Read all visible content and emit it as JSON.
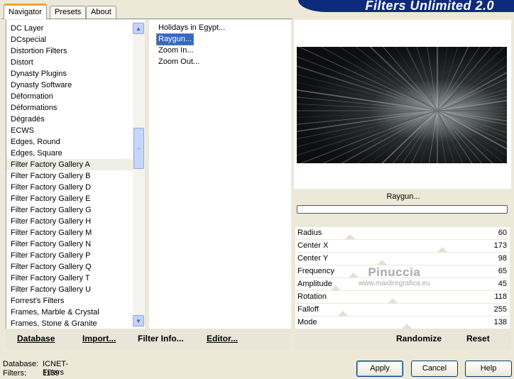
{
  "banner": {
    "title": "Filters Unlimited 2.0"
  },
  "tabs": [
    {
      "label": "Navigator"
    },
    {
      "label": "Presets"
    },
    {
      "label": "About"
    }
  ],
  "categories": [
    "DC Layer",
    "DCspecial",
    "Distortion Filters",
    "Distort",
    "Dynasty Plugins",
    "Dynasty Software",
    "Déformation",
    "Déformations",
    "Dégradés",
    "ECWS",
    "Edges, Round",
    "Edges, Square",
    "Filter Factory Gallery A",
    "Filter Factory Gallery B",
    "Filter Factory Gallery D",
    "Filter Factory Gallery E",
    "Filter Factory Gallery G",
    "Filter Factory Gallery H",
    "Filter Factory Gallery M",
    "Filter Factory Gallery N",
    "Filter Factory Gallery P",
    "Filter Factory Gallery Q",
    "Filter Factory Gallery T",
    "Filter Factory Gallery U",
    "Forrest's Filters",
    "Frames, Marble & Crystal",
    "Frames, Stone & Granite"
  ],
  "selected_category": "Filter Factory Gallery A",
  "filters": [
    "Holidays in Egypt...",
    "Raygun...",
    "Zoom In...",
    "Zoom Out..."
  ],
  "selected_filter": "Raygun...",
  "current_filter_label": "Raygun...",
  "progress": 0,
  "params": [
    {
      "name": "Radius",
      "value": "60"
    },
    {
      "name": "Center X",
      "value": "173"
    },
    {
      "name": "Center Y",
      "value": "98"
    },
    {
      "name": "Frequency",
      "value": "65"
    },
    {
      "name": "Amplitude",
      "value": "45"
    },
    {
      "name": "Rotation",
      "value": "118"
    },
    {
      "name": "Falloff",
      "value": "255"
    },
    {
      "name": "Mode",
      "value": "138"
    }
  ],
  "watermark": {
    "line1": "Pinuccia",
    "line2": "www.maidiregrafica.eu"
  },
  "toolbar": {
    "database": "Database",
    "import": "Import...",
    "filter_info": "Filter Info...",
    "editor": "Editor...",
    "randomize": "Randomize",
    "reset": "Reset"
  },
  "status": {
    "database_label": "Database:",
    "database_value": "ICNET-Filters",
    "filters_label": "Filters:",
    "filters_value": "1159"
  },
  "buttons": {
    "apply": "Apply",
    "cancel": "Cancel",
    "help": "Help"
  }
}
